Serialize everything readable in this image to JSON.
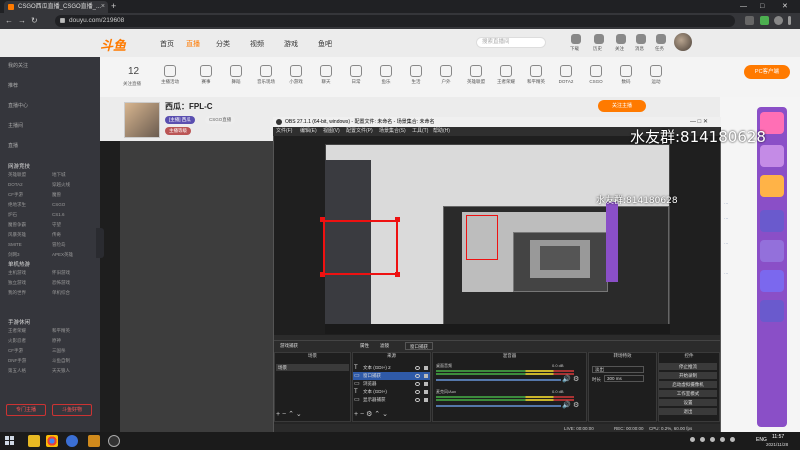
{
  "browser": {
    "tab_title": "CSGO西瓜直播_CSGO直播_...",
    "url": "douyu.com/219608",
    "new_tab": "+",
    "tab_close": "×",
    "win_min": "—",
    "win_max": "□",
    "win_close": "✕"
  },
  "douyu": {
    "logo": "斗鱼",
    "nav": [
      "首页",
      "直播",
      "分类",
      "视频",
      "游戏",
      "鱼吧"
    ],
    "search_placeholder": "搜索直播间",
    "header_icons": [
      "下载",
      "历史",
      "关注",
      "消息",
      "任务",
      "创作"
    ],
    "category_count": "12",
    "category_count_label": "关注直播",
    "categories": [
      "主播活动",
      "赛事",
      "舞蹈",
      "音乐现场",
      "小游戏",
      "聊天",
      "日常",
      "鱼乐",
      "生活",
      "户外",
      "英雄联盟",
      "王者荣耀",
      "和平精英",
      "DOTA2",
      "CSGO",
      "数码",
      "运动"
    ],
    "pc_button": "PC客户端"
  },
  "sidebar": {
    "items": [
      "我的关注",
      "推荐",
      "直播中心",
      "主播间",
      "直播"
    ],
    "section1": "网游竞技",
    "grid1": [
      "英雄联盟",
      "地下城",
      "DOTA2",
      "穿越火线",
      "CF手游",
      "魔兽",
      "绝地求生",
      "CSGO",
      "炉石",
      "CS1.6",
      "魔兽争霸",
      "守望",
      "风暴英雄",
      "传奇",
      "SMITE",
      "冒险岛",
      "剑网3",
      "APEX英雄"
    ],
    "section2": "单机热游",
    "grid2": [
      "主机游戏",
      "怀旧游戏",
      "独立游戏",
      "恐怖游戏",
      "我的世界",
      "单机综合"
    ],
    "section3": "手游休闲",
    "grid3": [
      "王者荣耀",
      "和平精英",
      "火影忍者",
      "原神",
      "CF手游",
      "三国杀",
      "DNF手游",
      "斗鱼自制",
      "第五人格",
      "天天狼人"
    ],
    "btn_left": "专门主播",
    "btn_right": "斗鱼好物"
  },
  "stream": {
    "title": "西瓜：FPL-C",
    "streamer_name": "[主播] 西瓜",
    "tag1": "CSGO直播",
    "tag2": "主播等级",
    "follow_btn": "关注主播",
    "follow_count": "主播热度：21万"
  },
  "watermark": {
    "big": "水友群:814180628",
    "small": "水友群:814180628"
  },
  "obs": {
    "title": "OBS 27.1.1 (64-bit, windows) - 配置文件: 未命名 - 场景集合: 未命名",
    "menu": [
      "文件(F)",
      "编辑(E)",
      "视图(V)",
      "配置文件(P)",
      "场景集合(S)",
      "工具(T)",
      "帮助(H)"
    ],
    "source_name": "游戏捕获",
    "props_btn": "属性",
    "filter_btn": "滤镜",
    "capture_label": "窗口捕获",
    "docks": {
      "scenes": "场景",
      "sources": "来源",
      "mixer": "混音器",
      "transitions": "转场特效",
      "controls": "控件"
    },
    "scene_item": "场景",
    "sources": [
      "文本 (GDI+) 2",
      "窗口捕获",
      "浏览器",
      "文本 (GDI+)",
      "显示器捕获"
    ],
    "mixer": [
      {
        "name": "桌面音频",
        "level": "0.0 dB"
      },
      {
        "name": "麦克风/Aux",
        "level": "0.0 dB"
      }
    ],
    "transition_type": "淡出",
    "duration_label": "时长",
    "duration_value": "300 ms",
    "controls": [
      "停止推流",
      "开始录制",
      "启动虚拟摄像机",
      "工作室模式",
      "设置",
      "退出"
    ],
    "status": {
      "live": "LIVE: 00:00:00",
      "rec": "REC: 00:00:00",
      "cpu": "CPU: 0.2%, 60.00 fps"
    }
  },
  "taskbar": {
    "time": "11:57",
    "date": "2021/11/28",
    "lang": "ENG"
  },
  "colors": {
    "douyu_orange": "#ff7a00",
    "obs_bg": "#2b2b2b",
    "highlight_red": "#e11111",
    "purple_promo": "#8a4fc7"
  }
}
